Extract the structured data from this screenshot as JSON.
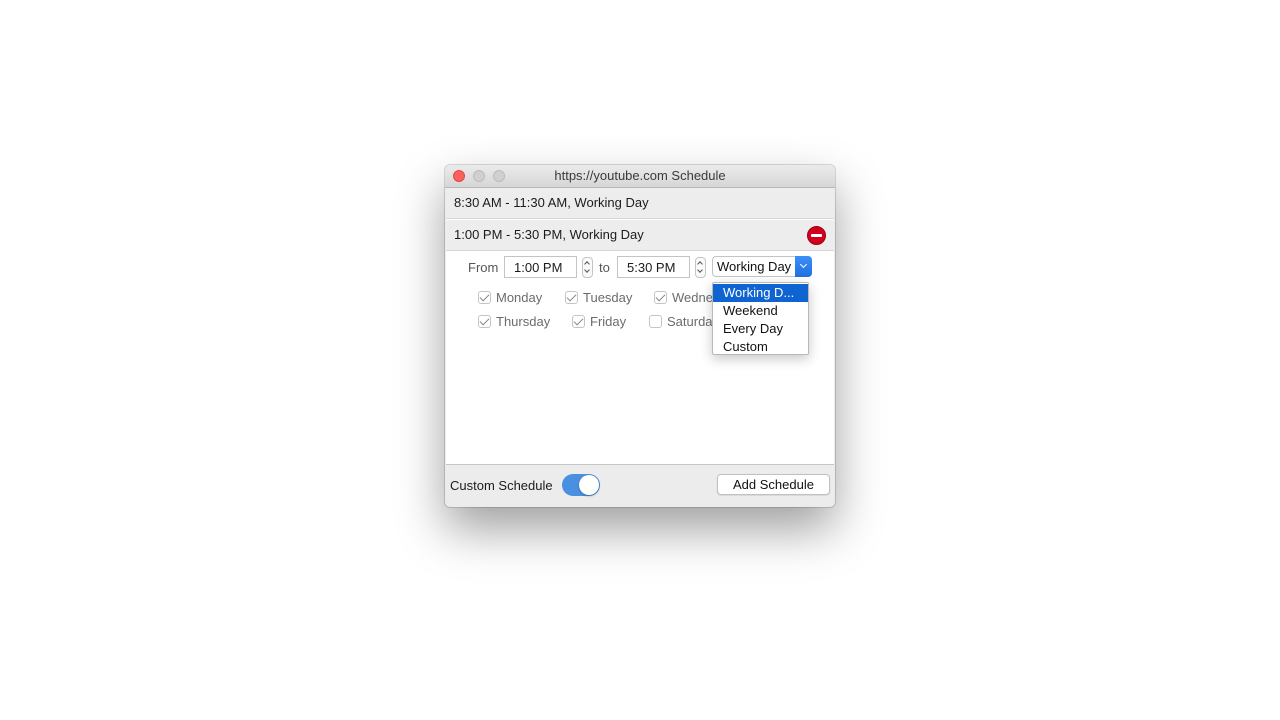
{
  "window": {
    "title": "https://youtube.com Schedule"
  },
  "schedules": [
    {
      "label": "8:30 AM - 11:30 AM, Working Day"
    },
    {
      "label": "1:00 PM - 5:30 PM, Working Day"
    }
  ],
  "editor": {
    "from_label": "From",
    "from_value": "1:00 PM",
    "to_label": "to",
    "to_value": "5:30 PM",
    "preset_value": "Working Day",
    "days": [
      {
        "label": "Monday",
        "checked": true
      },
      {
        "label": "Tuesday",
        "checked": true
      },
      {
        "label": "Wedne",
        "checked": true
      },
      {
        "label": "Thursday",
        "checked": true
      },
      {
        "label": "Friday",
        "checked": true
      },
      {
        "label": "Saturda",
        "checked": false
      }
    ]
  },
  "menu": {
    "items": [
      {
        "label": "Working D...",
        "selected": true
      },
      {
        "label": "Weekend",
        "selected": false
      },
      {
        "label": "Every Day",
        "selected": false
      },
      {
        "label": "Custom",
        "selected": false
      }
    ]
  },
  "footer": {
    "custom_schedule_label": "Custom Schedule",
    "custom_schedule_on": true,
    "add_button_label": "Add Schedule"
  },
  "colors": {
    "accent": "#4a90e2",
    "menu_selection": "#0f64d2",
    "remove": "#d0021b",
    "close": "#fc605c"
  }
}
